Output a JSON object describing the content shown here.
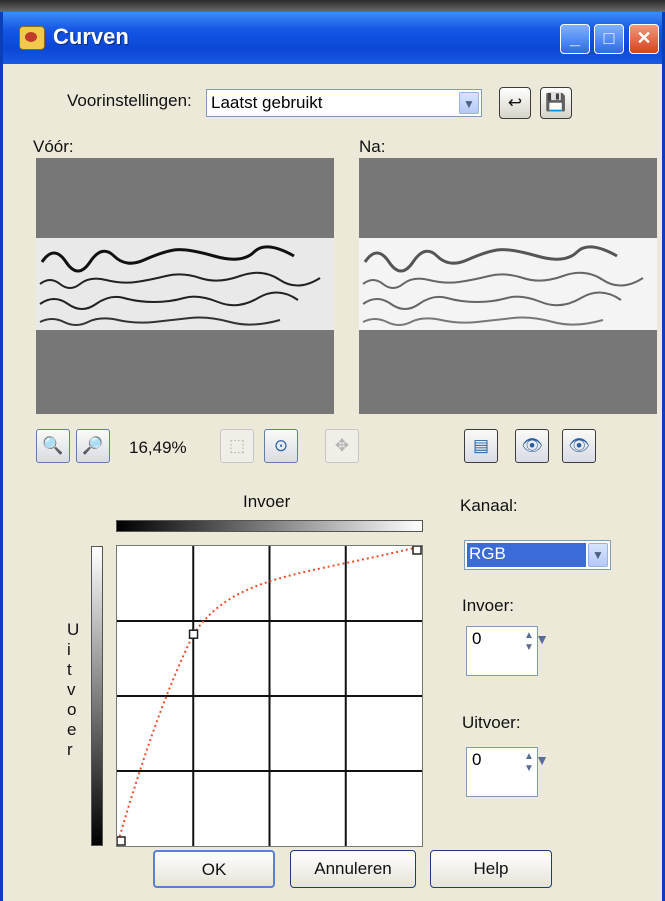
{
  "window": {
    "title": "Curven",
    "buttons": {
      "minimize": "_",
      "maximize": "□",
      "close": "✕"
    }
  },
  "presets": {
    "label": "Voorinstellingen:",
    "selected": "Laatst gebruikt",
    "icons": [
      "reset-icon",
      "save-icon"
    ]
  },
  "preview": {
    "before_label": "Vóór:",
    "after_label": "Na:"
  },
  "zoom": {
    "level": "16,49%"
  },
  "curve": {
    "input_label": "Invoer",
    "output_label_letters": [
      "U",
      "i",
      "t",
      "v",
      "o",
      "e",
      "r"
    ],
    "points": [
      [
        0,
        0
      ],
      [
        64,
        180
      ],
      [
        255,
        255
      ]
    ],
    "curve_color": "#e8502a"
  },
  "channel": {
    "label": "Kanaal:",
    "selected": "RGB",
    "selected_bg": "#3b6bd8"
  },
  "input_field": {
    "label": "Invoer:",
    "value": "0"
  },
  "output_field": {
    "label": "Uitvoer:",
    "value": "0"
  },
  "buttons": {
    "ok": "OK",
    "cancel": "Annuleren",
    "help": "Help"
  }
}
